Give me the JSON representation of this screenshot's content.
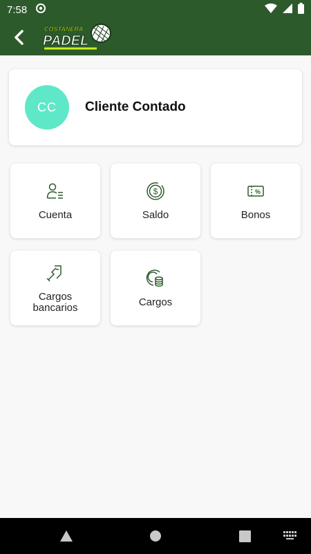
{
  "status_bar": {
    "time": "7:58"
  },
  "app": {
    "logo_top": "COSTANERA",
    "logo_main": "PADEL"
  },
  "profile": {
    "initials": "CC",
    "name": "Cliente Contado"
  },
  "tiles": [
    {
      "label": "Cuenta",
      "icon": "user-list-icon"
    },
    {
      "label": "Saldo",
      "icon": "dollar-coin-icon"
    },
    {
      "label": "Bonos",
      "icon": "discount-ticket-icon"
    },
    {
      "label": "Cargos bancarios",
      "icon": "card-swipe-icon"
    },
    {
      "label": "Cargos",
      "icon": "coins-stack-icon"
    }
  ],
  "colors": {
    "header": "#2d5a2b",
    "avatar": "#5ee8c8",
    "icon": "#2d5a2b"
  }
}
